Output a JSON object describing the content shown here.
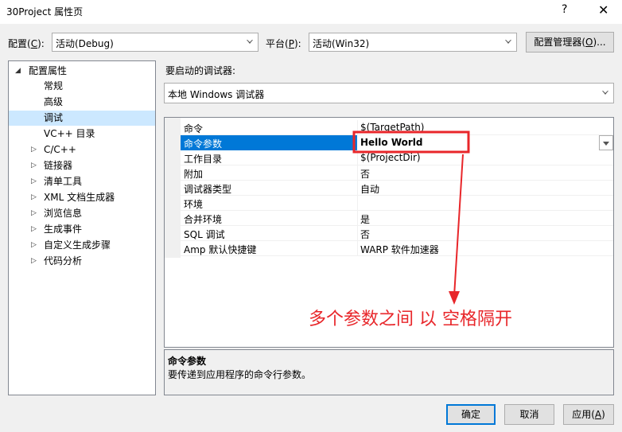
{
  "window": {
    "title": "30Project 属性页",
    "help_glyph": "?",
    "close_glyph": "✕"
  },
  "config": {
    "label_pre": "配置(",
    "label_key": "C",
    "label_post": "):",
    "value": "活动(Debug)"
  },
  "platform": {
    "label_pre": "平台(",
    "label_key": "P",
    "label_post": "):",
    "value": "活动(Win32)"
  },
  "config_manager": {
    "label_pre": "配置管理器(",
    "label_key": "O",
    "label_post": ")..."
  },
  "tree": {
    "root": "配置属性",
    "items": [
      "常规",
      "高级",
      "调试",
      "VC++ 目录",
      "C/C++",
      "链接器",
      "清单工具",
      "XML 文档生成器",
      "浏览信息",
      "生成事件",
      "自定义生成步骤",
      "代码分析"
    ]
  },
  "debugger": {
    "label": "要启动的调试器:",
    "value": "本地 Windows 调试器"
  },
  "properties": [
    {
      "name": "命令",
      "value": "$(TargetPath)"
    },
    {
      "name": "命令参数",
      "value": "Hello World"
    },
    {
      "name": "工作目录",
      "value": "$(ProjectDir)"
    },
    {
      "name": "附加",
      "value": "否"
    },
    {
      "name": "调试器类型",
      "value": "自动"
    },
    {
      "name": "环境",
      "value": ""
    },
    {
      "name": "合并环境",
      "value": "是"
    },
    {
      "name": "SQL 调试",
      "value": "否"
    },
    {
      "name": "Amp 默认快捷键",
      "value": "WARP 软件加速器"
    }
  ],
  "annotation": {
    "text": "多个参数之间 以 空格隔开",
    "color": "#e8262a"
  },
  "description": {
    "title": "命令参数",
    "text": "要传递到应用程序的命令行参数。"
  },
  "buttons": {
    "ok": "确定",
    "cancel": "取消",
    "apply_pre": "应用(",
    "apply_key": "A",
    "apply_post": ")"
  },
  "colors": {
    "selection": "#0078d7",
    "tree_selection": "#cce8ff"
  }
}
